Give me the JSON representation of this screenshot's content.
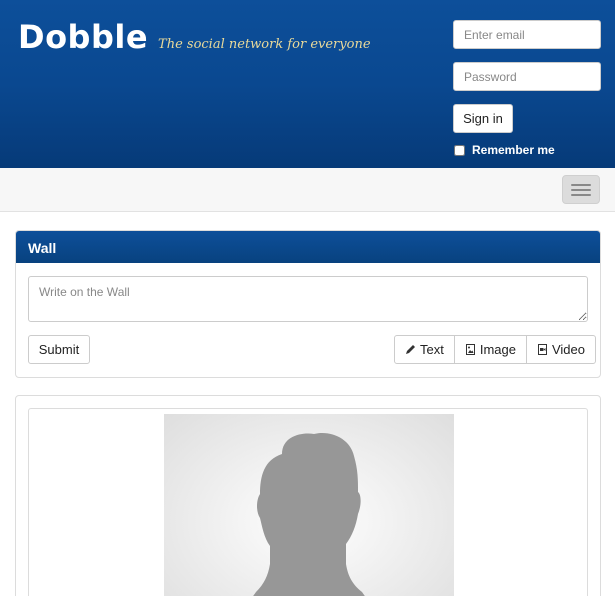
{
  "header": {
    "brand": "Dobble",
    "tagline": "The social network for everyone",
    "email_placeholder": "Enter email",
    "password_placeholder": "Password",
    "signin_label": "Sign in",
    "remember_label": "Remember me"
  },
  "wall": {
    "title": "Wall",
    "textarea_placeholder": "Write on the Wall",
    "submit_label": "Submit",
    "type_buttons": {
      "text": "Text",
      "image": "Image",
      "video": "Video"
    }
  },
  "colors": {
    "header_blue": "#0a4890",
    "tagline_gold": "#e8d99a",
    "navbar_bg": "#f7f7f7"
  }
}
